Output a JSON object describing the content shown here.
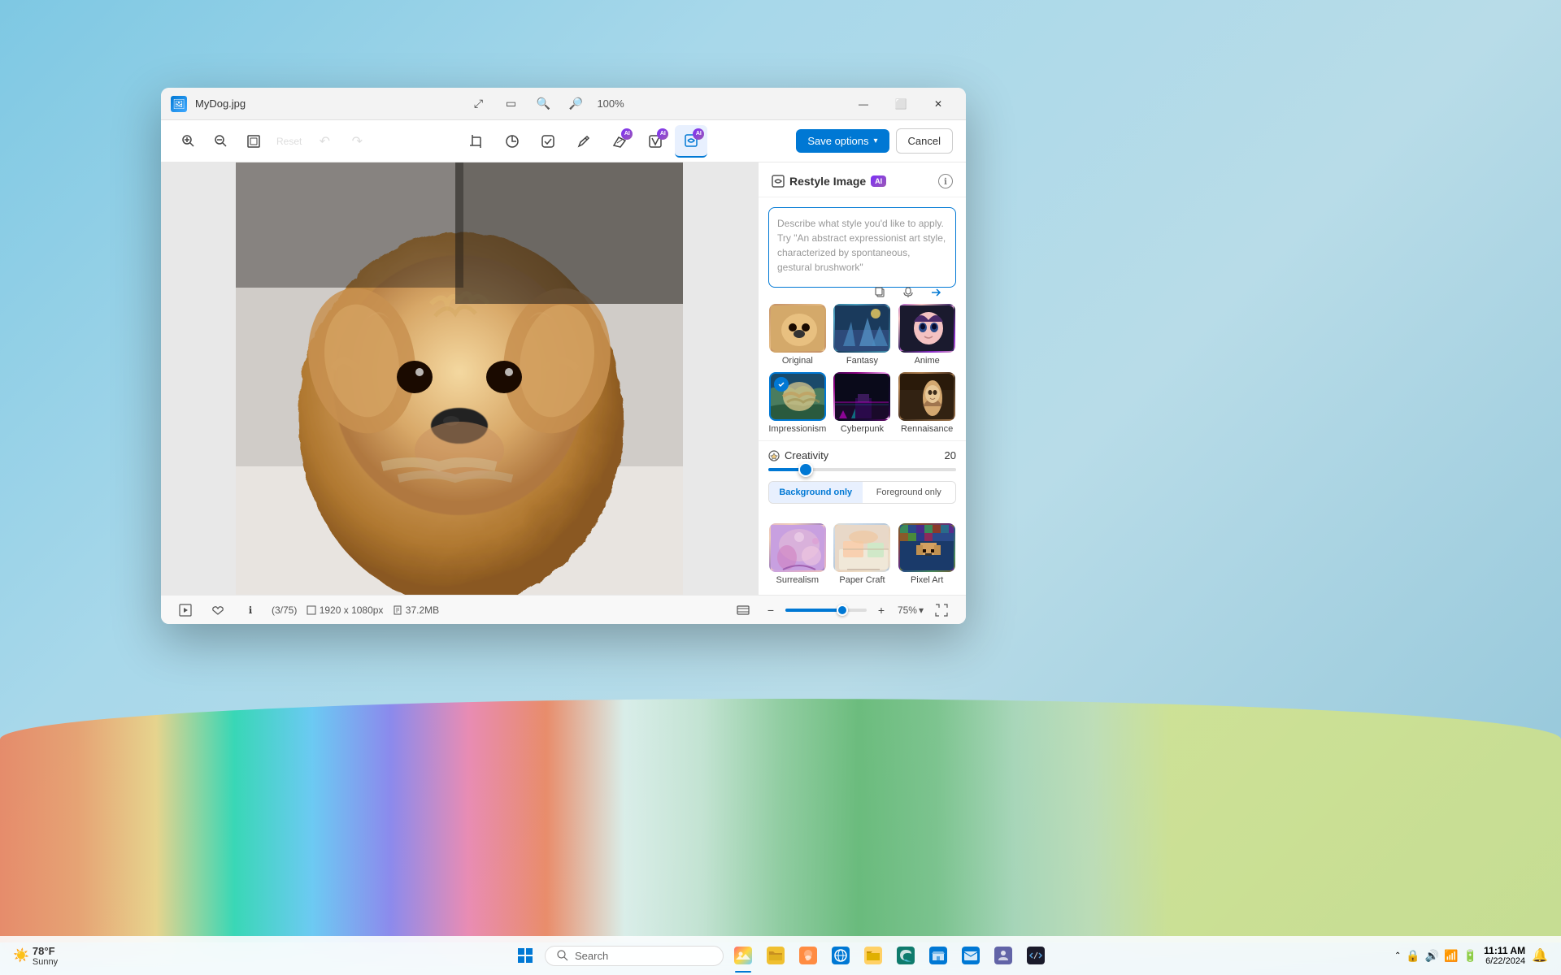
{
  "desktop": {
    "background": "sky blue gradient"
  },
  "window": {
    "title": "MyDog.jpg",
    "app_icon": "🖼",
    "controls": {
      "minimize": "—",
      "maximize": "⬜",
      "close": "✕"
    },
    "top_buttons": {
      "fit": "⊡",
      "frame": "⊞",
      "zoom_out": "🔍",
      "zoom_in": "🔍",
      "zoom_percent": "100%"
    }
  },
  "toolbar": {
    "zoom_in_label": "🔍+",
    "zoom_out_label": "🔍-",
    "fit_label": "⊡",
    "reset_label": "Reset",
    "undo_label": "↶",
    "redo_label": "↷",
    "crop_label": "⊹",
    "adjust_label": "☀",
    "filter_label": "⬟",
    "draw_label": "✏",
    "erase_label": "✦",
    "generative_label": "✦",
    "restyle_label": "🖼",
    "save_options_label": "Save options",
    "cancel_label": "Cancel"
  },
  "right_panel": {
    "title": "Restyle Image",
    "ai_badge": "AI",
    "info_icon": "ℹ",
    "placeholder_text": "Describe what style you'd like to apply. Try \"An abstract expressionist art style, characterized by spontaneous, gestural brushwork\"",
    "input_actions": {
      "paste": "📋",
      "mic": "🎤",
      "send": "▷"
    },
    "styles": [
      {
        "id": "original",
        "label": "Original",
        "selected": false,
        "thumb_class": "thumb-original"
      },
      {
        "id": "fantasy",
        "label": "Fantasy",
        "selected": false,
        "thumb_class": "thumb-fantasy"
      },
      {
        "id": "anime",
        "label": "Anime",
        "selected": false,
        "thumb_class": "thumb-anime"
      },
      {
        "id": "impressionism",
        "label": "Impressionism",
        "selected": true,
        "thumb_class": "thumb-impressionism"
      },
      {
        "id": "cyberpunk",
        "label": "Cyberpunk",
        "selected": false,
        "thumb_class": "thumb-cyberpunk"
      },
      {
        "id": "renaissance",
        "label": "Rennaisance",
        "selected": false,
        "thumb_class": "thumb-renaissance"
      }
    ],
    "creativity": {
      "label": "Creativity",
      "value": 20,
      "fill_percent": 20
    },
    "toggle": {
      "background_only": "Background only",
      "foreground_only": "Foreground only",
      "active": "background"
    },
    "bottom_styles": [
      {
        "id": "surrealism",
        "label": "Surrealism",
        "thumb_class": "thumb-surrealism"
      },
      {
        "id": "papercraft",
        "label": "Paper Craft",
        "thumb_class": "thumb-papercraft"
      },
      {
        "id": "pixelart",
        "label": "Pixel Art",
        "thumb_class": "thumb-pixelart"
      }
    ]
  },
  "status_bar": {
    "slideshow_icon": "⊡",
    "like_icon": "♡",
    "info_icon": "ℹ",
    "position": "3/75",
    "dimensions": "1920 x 1080px",
    "size": "37.2MB",
    "thumbnail_icon": "⊟",
    "zoom_value": "75%",
    "zoom_out": "—",
    "zoom_in": "+",
    "fullscreen": "⛶"
  },
  "taskbar": {
    "weather": {
      "temp": "78°F",
      "condition": "Sunny",
      "icon": "☀"
    },
    "start_icon": "⊞",
    "search_placeholder": "Search",
    "apps": [
      "🔊",
      "📁",
      "🎨",
      "🌐",
      "📂",
      "🦊",
      "🛒",
      "📧",
      "👥",
      "💻"
    ],
    "tray": {
      "icons": [
        "⬆",
        "🔒",
        "🔊",
        "📶",
        "🔋",
        "🔔"
      ],
      "time": "11:11 AM",
      "date": "6/22/2024",
      "notification_icon": "🔔"
    }
  }
}
